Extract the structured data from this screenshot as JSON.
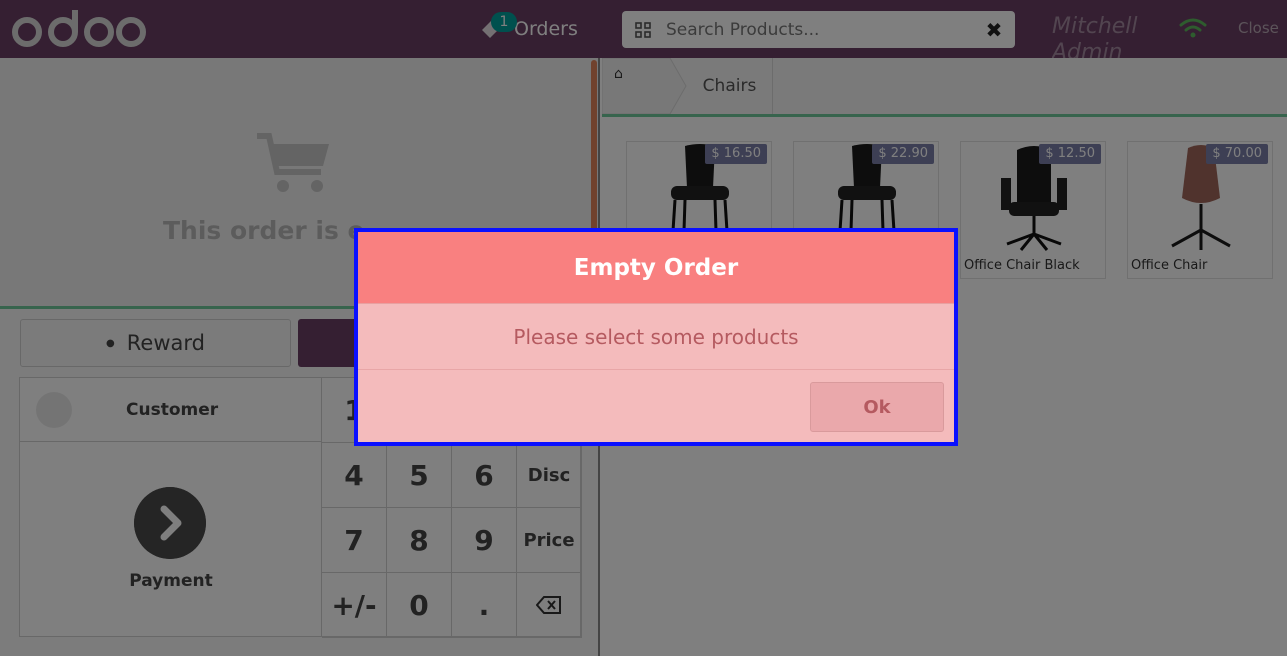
{
  "header": {
    "logo_text": "odoo",
    "orders_label": "Orders",
    "orders_count": "1",
    "search_placeholder": "Search Products...",
    "cashier_name": "Mitchell Admin",
    "close_label": "Close",
    "colors": {
      "header_bg": "#6b3e65",
      "badge": "#00a09d",
      "wifi": "#5cb85c"
    }
  },
  "order": {
    "empty_text": "This order is e",
    "reward_label": "Reward",
    "customer_label": "Customer",
    "payment_label": "Payment"
  },
  "numpad": {
    "keys": [
      "1",
      "4",
      "5",
      "6",
      "Disc",
      "7",
      "8",
      "9",
      "Price",
      "+/-",
      "0",
      "."
    ]
  },
  "breadcrumb": {
    "home_icon": "home-icon",
    "category": "Chairs"
  },
  "products": [
    {
      "name": "",
      "price": "$ 16.50"
    },
    {
      "name": "",
      "price": "$ 22.90"
    },
    {
      "name": "Office Chair Black",
      "price": "$ 12.50"
    },
    {
      "name": "Office Chair",
      "price": "$ 70.00"
    }
  ],
  "modal": {
    "title": "Empty Order",
    "message": "Please select some products",
    "ok_label": "Ok",
    "colors": {
      "header": "#f98080",
      "body": "#f4bbbc",
      "border": "#0a10ff",
      "text": "#b55a60"
    }
  }
}
